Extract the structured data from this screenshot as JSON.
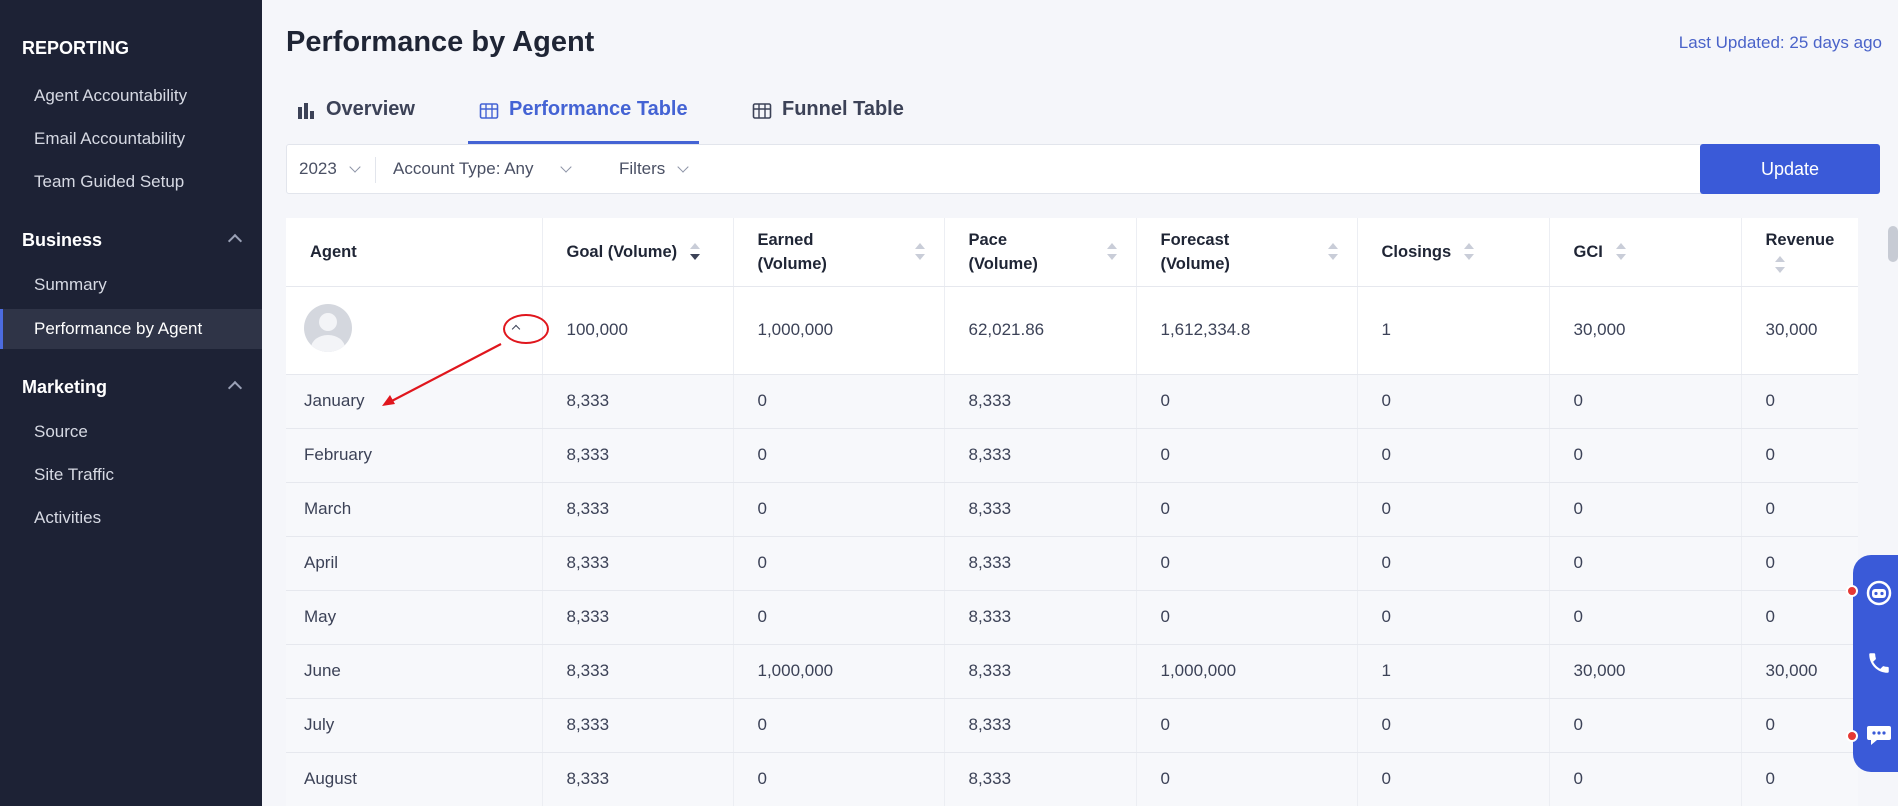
{
  "sidebar": {
    "heading": "REPORTING",
    "top_items": [
      "Agent Accountability",
      "Email Accountability",
      "Team Guided Setup"
    ],
    "business": {
      "label": "Business",
      "items": [
        "Summary",
        "Performance by Agent"
      ]
    },
    "marketing": {
      "label": "Marketing",
      "items": [
        "Source",
        "Site Traffic",
        "Activities"
      ]
    },
    "active_item": "Performance by Agent"
  },
  "page": {
    "title": "Performance by Agent",
    "last_updated": "Last Updated: 25 days ago"
  },
  "tabs": [
    {
      "label": "Overview",
      "icon": "bar-chart-icon",
      "active": false
    },
    {
      "label": "Performance Table",
      "icon": "table-icon",
      "active": true
    },
    {
      "label": "Funnel Table",
      "icon": "table-icon",
      "active": false
    }
  ],
  "filters": {
    "year": "2023",
    "account_type": "Account Type: Any",
    "filters_label": "Filters",
    "update_label": "Update"
  },
  "table": {
    "headers": {
      "agent": "Agent",
      "goal": "Goal (Volume)",
      "earned": "Earned (Volume)",
      "pace": "Pace (Volume)",
      "forecast": "Forecast (Volume)",
      "closings": "Closings",
      "gci": "GCI",
      "revenue": "Revenue"
    },
    "agent_row": {
      "goal": "100,000",
      "earned": "1,000,000",
      "pace": "62,021.86",
      "forecast": "1,612,334.8",
      "closings": "1",
      "gci": "30,000",
      "revenue": "30,000"
    },
    "months": [
      {
        "month": "January",
        "goal": "8,333",
        "earned": "0",
        "pace": "8,333",
        "forecast": "0",
        "closings": "0",
        "gci": "0",
        "revenue": "0"
      },
      {
        "month": "February",
        "goal": "8,333",
        "earned": "0",
        "pace": "8,333",
        "forecast": "0",
        "closings": "0",
        "gci": "0",
        "revenue": "0"
      },
      {
        "month": "March",
        "goal": "8,333",
        "earned": "0",
        "pace": "8,333",
        "forecast": "0",
        "closings": "0",
        "gci": "0",
        "revenue": "0"
      },
      {
        "month": "April",
        "goal": "8,333",
        "earned": "0",
        "pace": "8,333",
        "forecast": "0",
        "closings": "0",
        "gci": "0",
        "revenue": "0"
      },
      {
        "month": "May",
        "goal": "8,333",
        "earned": "0",
        "pace": "8,333",
        "forecast": "0",
        "closings": "0",
        "gci": "0",
        "revenue": "0"
      },
      {
        "month": "June",
        "goal": "8,333",
        "earned": "1,000,000",
        "pace": "8,333",
        "forecast": "1,000,000",
        "closings": "1",
        "gci": "30,000",
        "revenue": "30,000"
      },
      {
        "month": "July",
        "goal": "8,333",
        "earned": "0",
        "pace": "8,333",
        "forecast": "0",
        "closings": "0",
        "gci": "0",
        "revenue": "0"
      },
      {
        "month": "August",
        "goal": "8,333",
        "earned": "0",
        "pace": "8,333",
        "forecast": "0",
        "closings": "0",
        "gci": "0",
        "revenue": "0"
      }
    ]
  },
  "colors": {
    "sidebar_bg": "#1d2235",
    "accent": "#3a5ad8",
    "annotation": "#e0161d"
  },
  "floating_widget": {
    "icons": [
      "bot-icon",
      "phone-icon",
      "chat-icon"
    ]
  }
}
